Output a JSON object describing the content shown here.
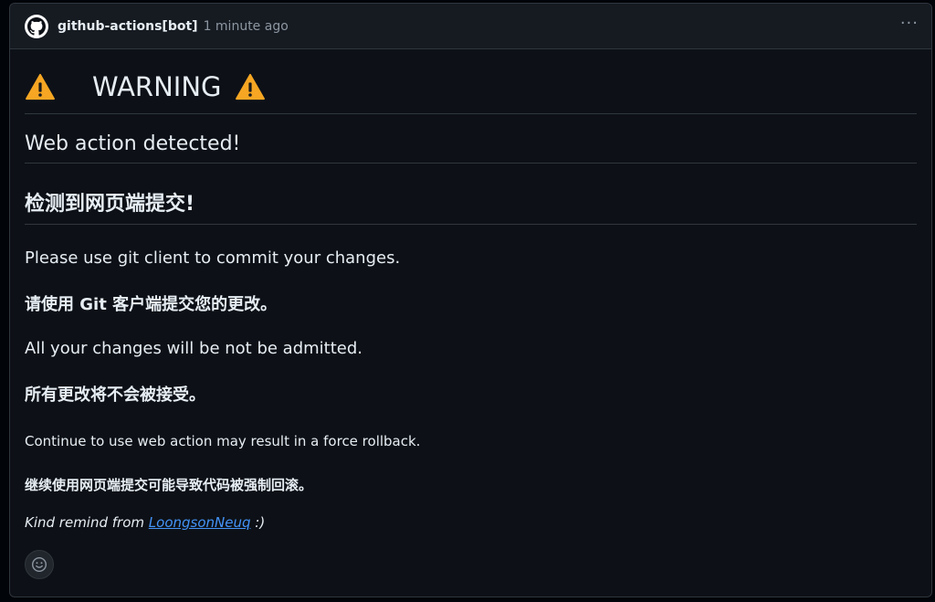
{
  "header": {
    "author": "github-actions[bot]",
    "timestamp": "1 minute ago",
    "menu_glyph": "···",
    "avatar_icon": "github-logo-icon"
  },
  "body": {
    "warning_title": "WARNING",
    "warning_icon": "warning-triangle-icon",
    "heading_en": "Web action detected!",
    "heading_cn": "检测到网页端提交!",
    "line1_en": "Please use git client to commit your changes.",
    "line1_cn": "请使用 Git 客户端提交您的更改。",
    "line2_en": "All your changes will be not be admitted.",
    "line2_cn": "所有更改将不会被接受。",
    "line3_en": "Continue to use web action may result in a force rollback.",
    "line3_cn": "继续使用网页端提交可能导致代码被强制回滚。",
    "remind_prefix": "Kind remind from ",
    "remind_link": "LoongsonNeuq",
    "remind_suffix": " :)"
  },
  "reactions": {
    "add_reaction_icon": "smiley-icon"
  },
  "colors": {
    "background": "#0d1117",
    "header_bg": "#161b22",
    "border": "#30363d",
    "link": "#4493f8",
    "warning": "#f6a623"
  }
}
